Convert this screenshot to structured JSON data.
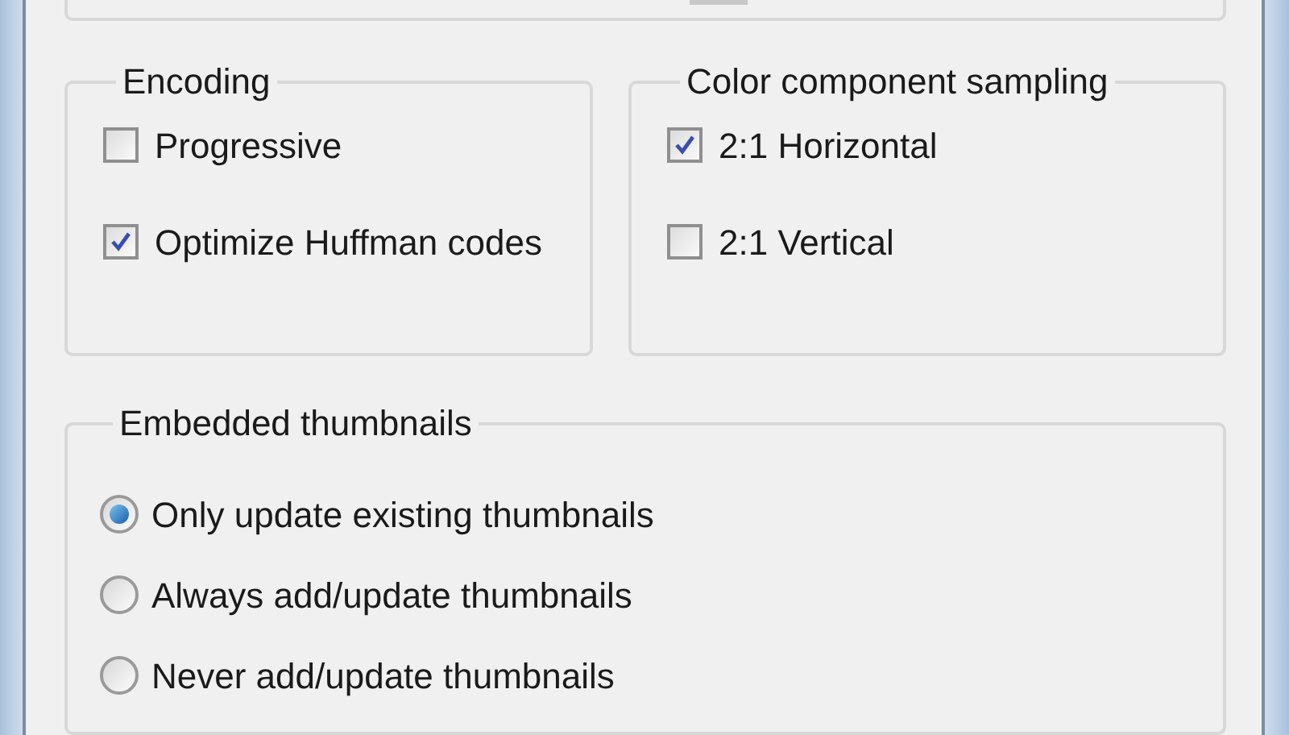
{
  "encoding": {
    "title": "Encoding",
    "options": [
      {
        "label": "Progressive",
        "checked": false
      },
      {
        "label": "Optimize Huffman codes",
        "checked": true
      }
    ]
  },
  "sampling": {
    "title": "Color component sampling",
    "options": [
      {
        "label": "2:1 Horizontal",
        "checked": true
      },
      {
        "label": "2:1 Vertical",
        "checked": false
      }
    ]
  },
  "thumbnails": {
    "title": "Embedded thumbnails",
    "options": [
      {
        "label": "Only update existing thumbnails",
        "selected": true
      },
      {
        "label": "Always add/update thumbnails",
        "selected": false
      },
      {
        "label": "Never add/update thumbnails",
        "selected": false
      }
    ]
  }
}
